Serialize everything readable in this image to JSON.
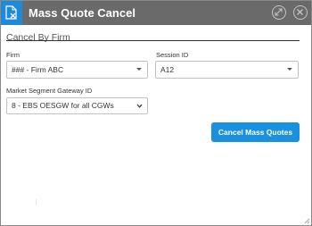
{
  "window": {
    "title": "Mass Quote Cancel"
  },
  "section": {
    "title": "Cancel By Firm"
  },
  "fields": {
    "firm": {
      "label": "Firm",
      "value": "### - Firm ABC"
    },
    "session": {
      "label": "Session ID",
      "value": "A12"
    },
    "gateway": {
      "label": "Market Segment Gateway ID",
      "value": "8 - EBS OESGW for all CGWs"
    }
  },
  "actions": {
    "cancel_label": "Cancel Mass Quotes"
  },
  "colors": {
    "titlebar": "#6a6a6a",
    "icon_bg": "#1e8ad8",
    "accent": "#1a91e0"
  },
  "icons": {
    "app": "document-x-icon",
    "expand": "expand-icon",
    "close": "close-icon"
  }
}
